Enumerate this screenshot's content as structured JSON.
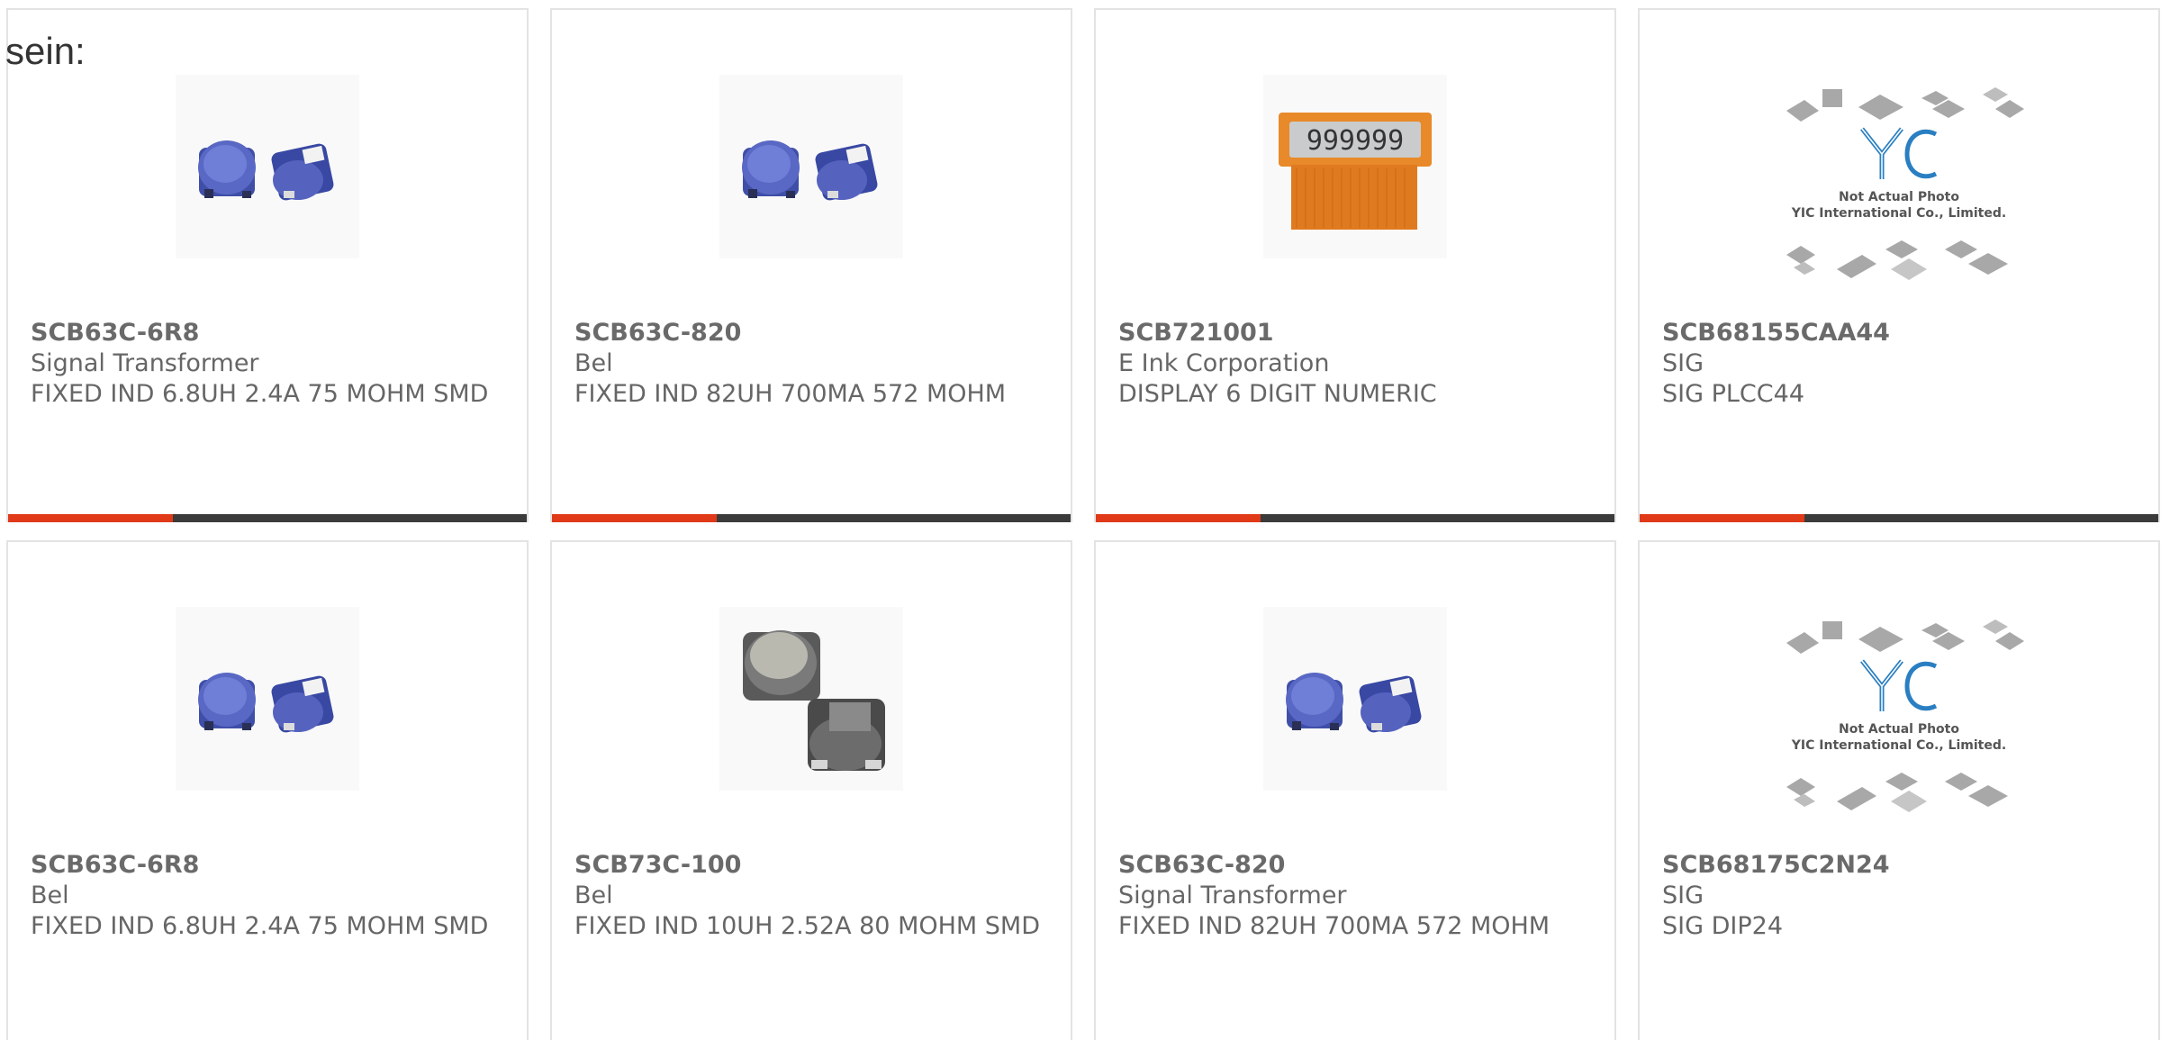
{
  "lead_text": "sein:",
  "colors": {
    "accent": "#e03a18",
    "bar": "#3b3b3b",
    "card_border": "#e3e3e3",
    "text": "#666666"
  },
  "products": [
    {
      "part_number": "SCB63C-6R8",
      "manufacturer": "Signal Transformer",
      "description": "FIXED IND 6.8UH 2.4A 75 MOHM SMD",
      "image": "blue-smd-inductor-photo"
    },
    {
      "part_number": "SCB63C-820",
      "manufacturer": "Bel",
      "description": "FIXED IND 82UH 700MA 572 MOHM",
      "image": "blue-smd-inductor-photo"
    },
    {
      "part_number": "SCB721001",
      "manufacturer": "E Ink Corporation",
      "description": "DISPLAY 6 DIGIT NUMERIC",
      "image": "numeric-display-photo",
      "display_digits": "999999"
    },
    {
      "part_number": "SCB68155CAA44",
      "manufacturer": "SIG",
      "description": "SIG PLCC44",
      "image": "placeholder-photo",
      "placeholder_text": [
        "Not Actual Photo",
        "YIC International Co., Limited."
      ]
    },
    {
      "part_number": "SCB63C-6R8",
      "manufacturer": "Bel",
      "description": "FIXED IND 6.8UH 2.4A 75 MOHM SMD",
      "image": "blue-smd-inductor-photo"
    },
    {
      "part_number": "SCB73C-100",
      "manufacturer": "Bel",
      "description": "FIXED IND 10UH 2.52A 80 MOHM SMD",
      "image": "grey-smd-inductor-photo"
    },
    {
      "part_number": "SCB63C-820",
      "manufacturer": "Signal Transformer",
      "description": "FIXED IND 82UH 700MA 572 MOHM",
      "image": "blue-smd-inductor-photo"
    },
    {
      "part_number": "SCB68175C2N24",
      "manufacturer": "SIG",
      "description": "SIG DIP24",
      "image": "placeholder-photo",
      "placeholder_text": [
        "Not Actual Photo",
        "YIC International Co., Limited."
      ]
    }
  ]
}
